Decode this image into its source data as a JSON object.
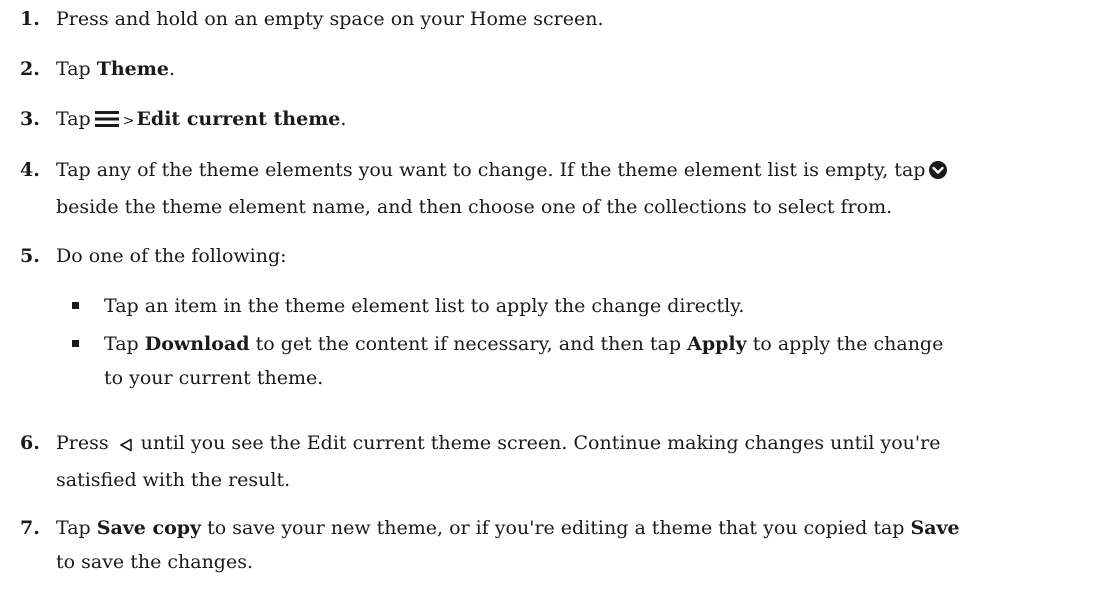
{
  "steps": [
    {
      "num": "1.",
      "text": "Press and hold on an empty space on your Home screen."
    },
    {
      "num": "2.",
      "pre": "Tap ",
      "bold": "Theme",
      "post": "."
    },
    {
      "num": "3.",
      "pre": "Tap",
      "sep": ">",
      "bold": "Edit current theme",
      "post": ".",
      "icon": "menu-icon"
    },
    {
      "num": "4.",
      "line1": "Tap any of the theme elements you want to change. If the theme element list is empty, tap",
      "line2": "beside the theme element name, and then choose one of the collections to select from.",
      "icon": "chevron-down-circle-icon"
    },
    {
      "num": "5.",
      "text": "Do one of the following:"
    },
    {
      "num": "6.",
      "pre": "Press",
      "line1_post": "until you see the Edit current theme screen. Continue making changes until you're",
      "line2": "satisfied with the result.",
      "icon": "back-triangle-icon"
    },
    {
      "num": "7.",
      "pre": "Tap ",
      "bold1": "Save copy",
      "mid": " to save your new theme, or if you're editing a theme that you copied tap ",
      "bold2": "Save",
      "line2": "to save the changes."
    }
  ],
  "bullets": [
    {
      "text": "Tap an item in the theme element list to apply the change directly."
    },
    {
      "pre": "Tap ",
      "bold1": "Download",
      "mid": " to get the content if necessary, and then tap ",
      "bold2": "Apply",
      "post": " to apply the change",
      "line2": "to your current theme."
    }
  ]
}
